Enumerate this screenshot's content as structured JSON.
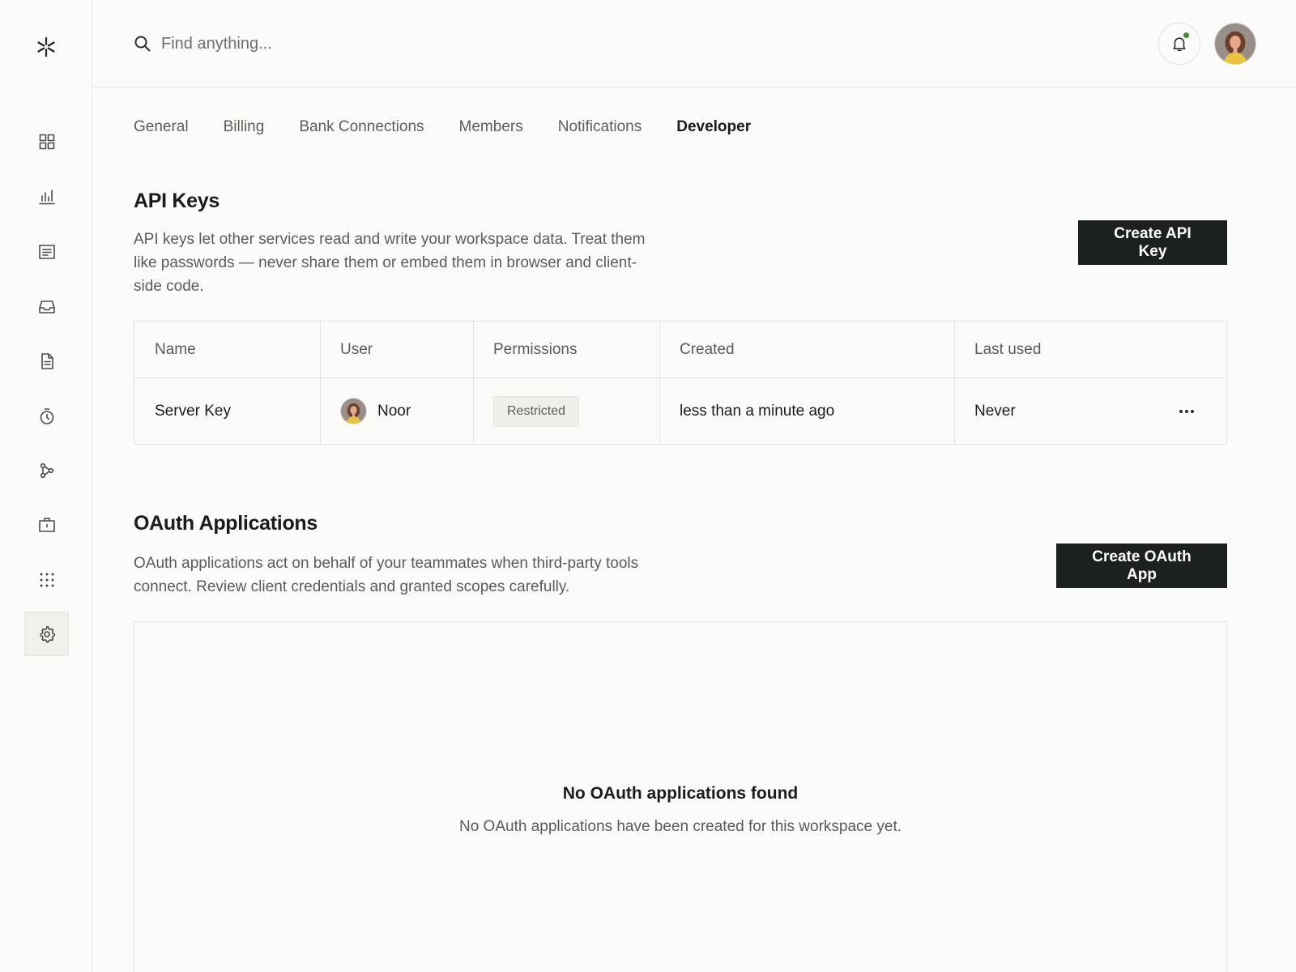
{
  "sidebar": {
    "logo": "asterisk-logo",
    "items": [
      {
        "name": "dashboard",
        "icon": "grid-icon",
        "active": false
      },
      {
        "name": "analytics",
        "icon": "bar-chart-icon",
        "active": false
      },
      {
        "name": "transactions",
        "icon": "list-icon",
        "active": false
      },
      {
        "name": "inbox",
        "icon": "inbox-icon",
        "active": false
      },
      {
        "name": "documents",
        "icon": "document-icon",
        "active": false
      },
      {
        "name": "time-tracking",
        "icon": "timer-icon",
        "active": false
      },
      {
        "name": "workflows",
        "icon": "flow-icon",
        "active": false
      },
      {
        "name": "vault",
        "icon": "briefcase-icon",
        "active": false
      },
      {
        "name": "apps",
        "icon": "apps-grid-icon",
        "active": false
      },
      {
        "name": "settings",
        "icon": "gear-icon",
        "active": true
      }
    ]
  },
  "header": {
    "search_placeholder": "Find anything...",
    "notification_dot_color": "#3f8f2f"
  },
  "tabs": [
    {
      "label": "General",
      "active": false
    },
    {
      "label": "Billing",
      "active": false
    },
    {
      "label": "Bank Connections",
      "active": false
    },
    {
      "label": "Members",
      "active": false
    },
    {
      "label": "Notifications",
      "active": false
    },
    {
      "label": "Developer",
      "active": true
    }
  ],
  "api_keys": {
    "title": "API Keys",
    "description": "API keys let other services read and write your workspace data. Treat them like passwords — never share them or embed them in browser and client-side code.",
    "create_label": "Create API Key",
    "columns": [
      "Name",
      "User",
      "Permissions",
      "Created",
      "Last used"
    ],
    "rows": [
      {
        "name": "Server Key",
        "user": "Noor",
        "permissions": "Restricted",
        "created": "less than a minute ago",
        "last_used": "Never"
      }
    ]
  },
  "oauth": {
    "title": "OAuth Applications",
    "description": "OAuth applications act on behalf of your teammates when third-party tools connect. Review client credentials and granted scopes carefully.",
    "create_label": "Create OAuth App",
    "empty_title": "No OAuth applications found",
    "empty_desc": "No OAuth applications have been created for this workspace yet."
  },
  "colors": {
    "background": "#fbfbf9",
    "primary_button": "#1d211e",
    "border": "#e3e3df"
  }
}
